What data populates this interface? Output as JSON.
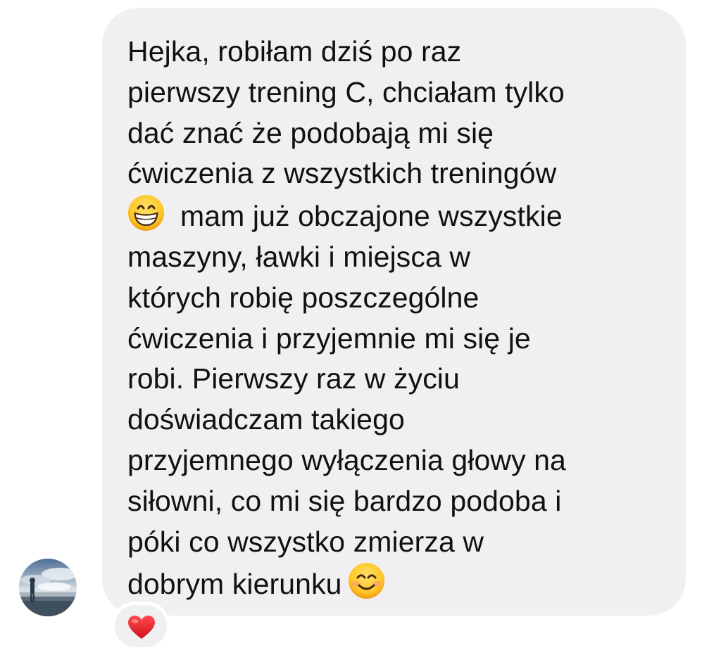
{
  "message": {
    "lines": [
      "Hejka, robiłam dziś po raz",
      "pierwszy trening C, chciałam tylko",
      "dać znać że podobają mi się",
      "ćwiczenia z wszystkich treningów",
      "mam już obczajone wszystkie",
      "maszyny, ławki i miejsca w",
      "których robię poszczególne",
      "ćwiczenia i przyjemnie mi się je",
      "robi. Pierwszy raz w życiu",
      "doświadczam takiego",
      "przyjemnego wyłączenia głowy na",
      "siłowni, co mi się bardzo podoba i",
      "póki co wszystko zmierza w",
      "dobrym kierunku"
    ],
    "emoji_inline_1": "grinning-face-emoji",
    "emoji_inline_2": "smiling-face-emoji"
  },
  "reaction": {
    "icon": "heart-icon",
    "color": "#e8202a"
  },
  "colors": {
    "bubble_bg": "#f0f0f3",
    "text": "#111111",
    "page_bg": "#ffffff"
  }
}
